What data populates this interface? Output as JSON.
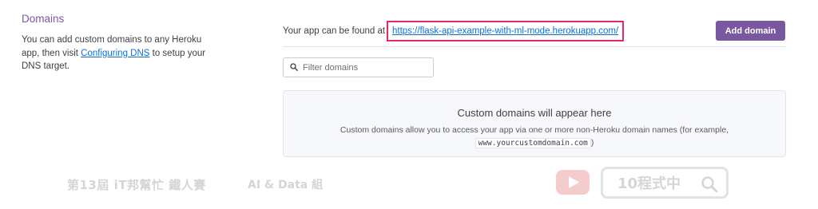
{
  "section": {
    "title": "Domains",
    "desc_before": "You can add custom domains to any Heroku app, then visit ",
    "desc_link": "Configuring DNS",
    "desc_after": " to setup your DNS target."
  },
  "app": {
    "found_label": "Your app can be found at",
    "url": "https://flask-api-example-with-ml-mode.herokuapp.com/",
    "add_domain_label": "Add domain"
  },
  "filter": {
    "placeholder": "Filter domains",
    "value": ""
  },
  "empty_state": {
    "title": "Custom domains will appear here",
    "desc_before": "Custom domains allow you to access your app via one or more non-Heroku domain names (for example, ",
    "example_domain": "www.yourcustomdomain.com",
    "desc_after": ")"
  },
  "watermark": {
    "left_text": "第13屆 iT邦幫忙 鐵人賽",
    "category": "AI & Data 組",
    "search_text": "10程式中"
  },
  "colors": {
    "accent": "#79589f",
    "link": "#0d6fd6",
    "highlight_border": "#e8285f"
  },
  "icons": [
    "search-icon",
    "youtube-play-icon",
    "magnifier-icon"
  ]
}
